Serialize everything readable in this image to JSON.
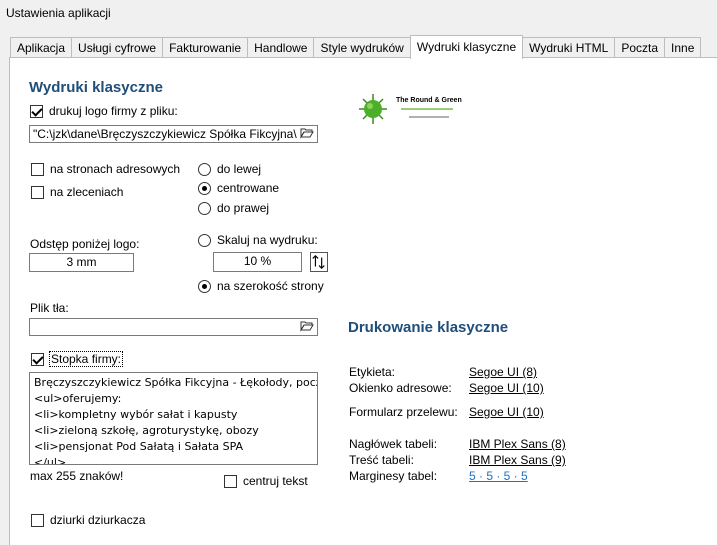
{
  "window": {
    "title": "Ustawienia aplikacji"
  },
  "tabs": [
    {
      "label": "Aplikacja"
    },
    {
      "label": "Usługi cyfrowe"
    },
    {
      "label": "Fakturowanie"
    },
    {
      "label": "Handlowe"
    },
    {
      "label": "Style wydruków"
    },
    {
      "label": "Wydruki klasyczne",
      "active": true
    },
    {
      "label": "Wydruki HTML"
    },
    {
      "label": "Poczta"
    },
    {
      "label": "Inne"
    }
  ],
  "left": {
    "heading": "Wydruki klasyczne",
    "print_logo_label": "drukuj logo firmy z pliku:",
    "print_logo_checked": true,
    "logo_path": "\"C:\\jzk\\dane\\Bręczyszczykiewicz Spółka Fikcyjna\\",
    "on_address_pages_label": "na stronach adresowych",
    "on_orders_label": "na zleceniach",
    "align_left_label": "do lewej",
    "align_center_label": "centrowane",
    "align_right_label": "do prawej",
    "align_selected": "center",
    "spacing_label": "Odstęp poniżej logo:",
    "spacing_value": "3 mm",
    "scale_label": "Skaluj na wydruku:",
    "scale_value": "10 %",
    "full_width_label": "na szerokość strony",
    "background_file_label": "Plik tła:",
    "background_file_value": "",
    "footer_label": "Stopka firmy:",
    "footer_checked": true,
    "footer_text": "Bręczyszczykiewicz Spółka Fikcyjna - Łękołody, pocz\n<ul>oferujemy:\n<li>kompletny wybór sałat i kapusty\n<li>zieloną szkołę, agroturystykę, obozy\n<li>pensjonat Pod Sałatą i Sałata SPA\n</ul>",
    "max_chars": "max 255 znaków!",
    "center_text_label": "centruj tekst",
    "punch_holes_label": "dziurki dziurkacza"
  },
  "logo": {
    "brand_text": "The Round & Green",
    "brand_color": "#2e8b2e"
  },
  "right": {
    "heading": "Drukowanie klasyczne",
    "rows": [
      {
        "label": "Etykieta:",
        "value": "Segoe UI (8)"
      },
      {
        "label": "Okienko adresowe:",
        "value": "Segoe UI (10)"
      },
      {
        "label": "Formularz przelewu:",
        "value": "Segoe UI (10)"
      },
      {
        "label": "Nagłówek tabeli:",
        "value": "IBM Plex Sans (8)"
      },
      {
        "label": "Treść tabeli:",
        "value": "IBM Plex Sans (9)"
      },
      {
        "label": "Marginesy tabel:",
        "value": "5 · 5 · 5 · 5"
      }
    ]
  }
}
